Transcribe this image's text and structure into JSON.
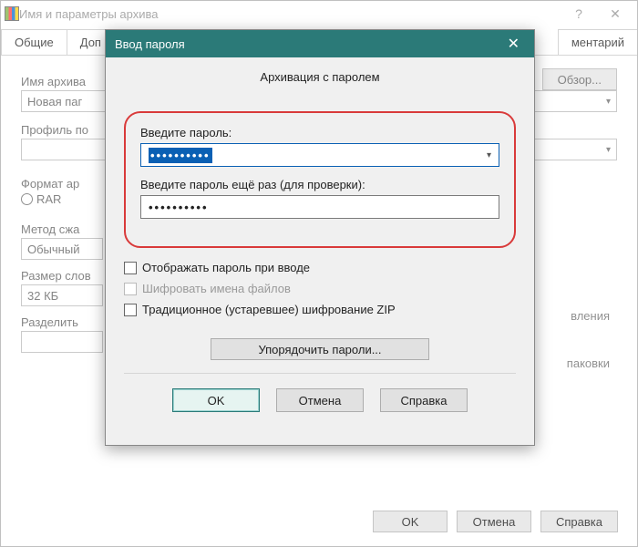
{
  "parent": {
    "title": "Имя и параметры архива",
    "tabs": {
      "general": "Общие",
      "advanced": "Доп",
      "comment": "ментарий"
    },
    "labels": {
      "archive_name": "Имя архива",
      "profile": "Профиль по",
      "format": "Формат ар",
      "method": "Метод сжа",
      "dictionary": "Размер слов",
      "split": "Разделить"
    },
    "values": {
      "archive_name": "Новая паг",
      "format_radio": "RAR",
      "method": "Обычный",
      "dictionary": "32 КБ"
    },
    "buttons": {
      "browse": "Обзор...",
      "ok": "OK",
      "cancel": "Отмена",
      "help": "Справка"
    },
    "right_hints": {
      "update": "вления",
      "packing": "паковки"
    }
  },
  "modal": {
    "title": "Ввод пароля",
    "heading": "Архивация с паролем",
    "labels": {
      "enter_pw": "Введите пароль:",
      "reenter_pw": "Введите пароль ещё раз (для проверки):"
    },
    "pw1_mask": "••••••••••",
    "pw2_mask": "••••••••••",
    "checks": {
      "show_pw": "Отображать пароль при вводе",
      "encrypt_names": "Шифровать имена файлов",
      "zip_legacy": "Традиционное (устаревшее) шифрование ZIP"
    },
    "organize": "Упорядочить пароли...",
    "buttons": {
      "ok": "OK",
      "cancel": "Отмена",
      "help": "Справка"
    }
  }
}
